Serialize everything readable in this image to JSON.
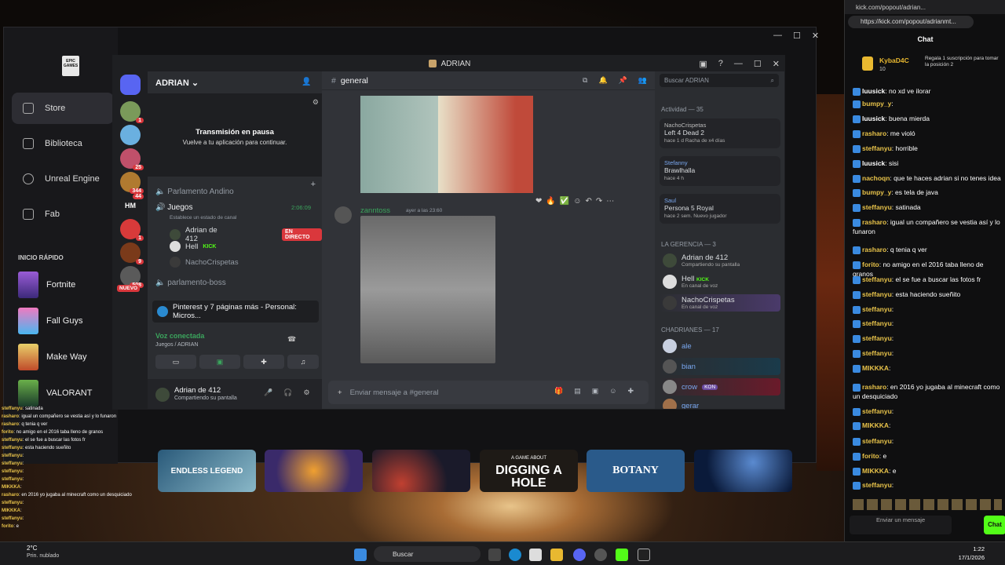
{
  "epic": {
    "logo_text": "EPIC GAMES",
    "nav": [
      {
        "label": "Store"
      },
      {
        "label": "Biblioteca"
      },
      {
        "label": "Unreal Engine"
      },
      {
        "label": "Fab"
      }
    ],
    "quick_launch_heading": "INICIO RÁPIDO",
    "games": [
      {
        "label": "Fortnite"
      },
      {
        "label": "Fall Guys"
      },
      {
        "label": "Make Way"
      },
      {
        "label": "VALORANT"
      }
    ],
    "carousel": [
      {
        "label": "ENDLESS LEGEND"
      },
      {
        "label": ""
      },
      {
        "label": ""
      },
      {
        "label": "DIGGING A HOLE"
      },
      {
        "label": "BOTANY"
      },
      {
        "label": ""
      }
    ],
    "carousel_sub": [
      "",
      "",
      "",
      "A GAME ABOUT",
      "",
      ""
    ]
  },
  "discord": {
    "window_title": "ADRIAN",
    "server_name": "ADRIAN",
    "channel_name": "general",
    "search_placeholder": "Buscar ADRIAN",
    "stream_paused_title": "Transmisión en pausa",
    "stream_paused_sub": "Vuelve a tu aplicación para continuar.",
    "voice_channel_1": "Parlamento Andino",
    "voice_channel_2": "Juegos",
    "voice_channel_2_time": "2:06:09",
    "voice_channel_2_status": "Establece un estado de canal",
    "voice_users": [
      {
        "name": "Adrian de 412",
        "tag": "EN DIRECTO"
      },
      {
        "name": "Hell",
        "tag": "KICK"
      },
      {
        "name": "NachoCrispetas",
        "tag": ""
      }
    ],
    "voice_channel_3": "parlamento-boss",
    "server_badges": [
      "1",
      "25",
      "344",
      "44",
      "1",
      "9",
      "508"
    ],
    "server_new": "NUEVO",
    "hm_label": "HM",
    "popup_text": "Pinterest y 7 páginas más - Personal: Micros...",
    "voice_connected": "Voz conectada",
    "voice_connected_sub": "Juegos / ADRIAN",
    "self_name": "Adrian de 412",
    "self_status": "Compartiendo su pantalla",
    "message_author": "zanntoss",
    "message_time": "ayer a las 23:60",
    "composer_placeholder": "Enviar mensaje a #general",
    "activity_heading": "Actividad — 35",
    "activities": [
      {
        "user": "NachoCrispetas",
        "game": "Left 4 Dead 2",
        "sub": "hace 1 d   Racha de x4 días"
      },
      {
        "user": "Stefanny",
        "game": "Brawlhalla",
        "sub": "hace 4 h"
      },
      {
        "user": "Saul",
        "game": "Persona 5 Royal",
        "sub": "hace 2 sem.   Nuevo jugador"
      }
    ],
    "group1_heading": "LA GERENCIA — 3",
    "group1": [
      {
        "name": "Adrian de 412",
        "sub": "Compartiendo su pantalla",
        "tag": ""
      },
      {
        "name": "Hell",
        "sub": "En canal de voz",
        "tag": "KICK"
      },
      {
        "name": "NachoCrispetas",
        "sub": "En canal de voz",
        "tag": ""
      }
    ],
    "group2_heading": "CHADRIANES — 17",
    "group2": [
      {
        "name": "ale",
        "tag": ""
      },
      {
        "name": "bian",
        "tag": ""
      },
      {
        "name": "crow",
        "tag": "KON"
      },
      {
        "name": "gerar",
        "tag": ""
      }
    ]
  },
  "chat": {
    "window_title": "kick.com/popout/adrian...",
    "url": "https://kick.com/popout/adrianmt...",
    "heading": "Chat",
    "top_user": "KybaD4C",
    "top_count": "10",
    "gift_text": "Regala 1 suscripción para tomar la posición 2",
    "messages": [
      {
        "user": "luusick",
        "text": "no xd ve ilorar"
      },
      {
        "user": "bumpy_y",
        "text": ""
      },
      {
        "user": "luusick",
        "text": "buena mierda"
      },
      {
        "user": "rasharo",
        "text": "me violó"
      },
      {
        "user": "steffanyu",
        "text": "horrible"
      },
      {
        "user": "luusick",
        "text": "sisi"
      },
      {
        "user": "nachoqn",
        "text": "que te haces adrian si no tenes idea"
      },
      {
        "user": "bumpy_y",
        "text": "es tela de java"
      },
      {
        "user": "steffanyu",
        "text": "satinada"
      },
      {
        "user": "rasharo",
        "text": "igual un compañero se vestia así y lo funaron"
      },
      {
        "user": "rasharo",
        "text": "q tenia q ver"
      },
      {
        "user": "forito",
        "text": "no amigo en el 2016 taba lleno de granos"
      },
      {
        "user": "steffanyu",
        "text": "el se fue a buscar las fotos fr"
      },
      {
        "user": "steffanyu",
        "text": "esta haciendo sueñito"
      },
      {
        "user": "steffanyu",
        "text": ""
      },
      {
        "user": "steffanyu",
        "text": ""
      },
      {
        "user": "steffanyu",
        "text": ""
      },
      {
        "user": "steffanyu",
        "text": ""
      },
      {
        "user": "MIKKKA",
        "text": ""
      },
      {
        "user": "rasharo",
        "text": "en 2016 yo jugaba al minecraft como un desquiciado"
      },
      {
        "user": "steffanyu",
        "text": ""
      },
      {
        "user": "MIKKKA",
        "text": ""
      },
      {
        "user": "steffanyu",
        "text": ""
      },
      {
        "user": "forito",
        "text": "e"
      },
      {
        "user": "MIKKKA",
        "text": "e"
      },
      {
        "user": "steffanyu",
        "text": ""
      }
    ],
    "send_placeholder": "Enviar un mensaje",
    "send_button": "Chat"
  },
  "overlay_chat": [
    {
      "user": "steffanyu",
      "text": "satinada"
    },
    {
      "user": "rasharo",
      "text": "igual un compañero se vestia así y lo funaron"
    },
    {
      "user": "rasharo",
      "text": "q tenia q ver"
    },
    {
      "user": "forito",
      "text": "no amigo en el 2016 taba lleno de granos"
    },
    {
      "user": "steffanyu",
      "text": "el se fue a buscar las fotos fr"
    },
    {
      "user": "steffanyu",
      "text": "esta haciendo sueñito"
    },
    {
      "user": "steffanyu",
      "text": ""
    },
    {
      "user": "steffanyu",
      "text": ""
    },
    {
      "user": "steffanyu",
      "text": ""
    },
    {
      "user": "steffanyu",
      "text": ""
    },
    {
      "user": "MIKKKA",
      "text": ""
    },
    {
      "user": "rasharo",
      "text": "en 2016 yo jugaba al minecraft como un desquiciado"
    },
    {
      "user": "steffanyu",
      "text": ""
    },
    {
      "user": "MIKKKA",
      "text": ""
    },
    {
      "user": "steffanyu",
      "text": ""
    },
    {
      "user": "forito",
      "text": "e"
    }
  ],
  "taskbar": {
    "weather_temp": "2°C",
    "weather_desc": "Prin. nublado",
    "search_label": "Buscar",
    "time": "1:22",
    "date": "17/1/2026"
  }
}
